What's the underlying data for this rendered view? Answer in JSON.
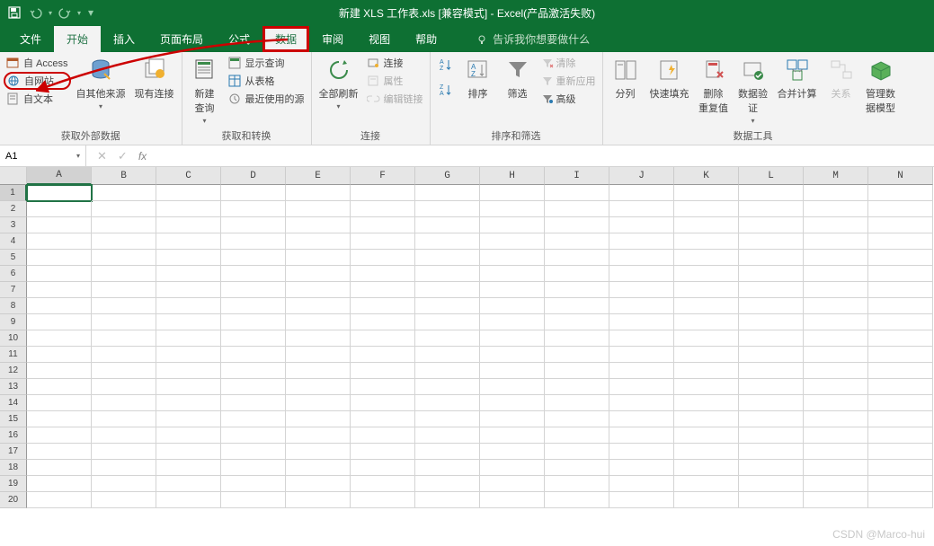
{
  "title": "新建 XLS 工作表.xls  [兼容模式]  -  Excel(产品激活失败)",
  "qat": {
    "save": "保存",
    "undo": "撤销",
    "redo": "恢复"
  },
  "tabs": {
    "file": "文件",
    "home": "开始",
    "insert": "插入",
    "pagelayout": "页面布局",
    "formulas": "公式",
    "data": "数据",
    "review": "审阅",
    "view": "视图",
    "help": "帮助"
  },
  "tellme": "告诉我你想要做什么",
  "ribbon": {
    "external": {
      "access": "自 Access",
      "web": "自网站",
      "text": "自文本",
      "other": "自其他来源",
      "existing": "现有连接",
      "label": "获取外部数据"
    },
    "transform": {
      "newquery": "新建\n查询",
      "showquery": "显示查询",
      "fromtable": "从表格",
      "recent": "最近使用的源",
      "label": "获取和转换"
    },
    "connections": {
      "refresh": "全部刷新",
      "conn": "连接",
      "props": "属性",
      "editlinks": "编辑链接",
      "label": "连接"
    },
    "sortfilter": {
      "sortaz": "升序",
      "sortza": "降序",
      "sort": "排序",
      "filter": "筛选",
      "clear": "清除",
      "reapply": "重新应用",
      "advanced": "高级",
      "label": "排序和筛选"
    },
    "datatools": {
      "texttocols": "分列",
      "flashfill": "快速填充",
      "removedupes": "删除\n重复值",
      "validation": "数据验\n证",
      "consolidate": "合并计算",
      "relations": "关系",
      "datamodel": "管理数\n据模型",
      "label": "数据工具"
    }
  },
  "namebox": "A1",
  "columns": [
    "A",
    "B",
    "C",
    "D",
    "E",
    "F",
    "G",
    "H",
    "I",
    "J",
    "K",
    "L",
    "M",
    "N"
  ],
  "rows": [
    "1",
    "2",
    "3",
    "4",
    "5",
    "6",
    "7",
    "8",
    "9",
    "10",
    "11",
    "12",
    "13",
    "14",
    "15",
    "16",
    "17",
    "18",
    "19",
    "20"
  ],
  "selected_cell": "A1",
  "watermark": "CSDN @Marco-hui"
}
